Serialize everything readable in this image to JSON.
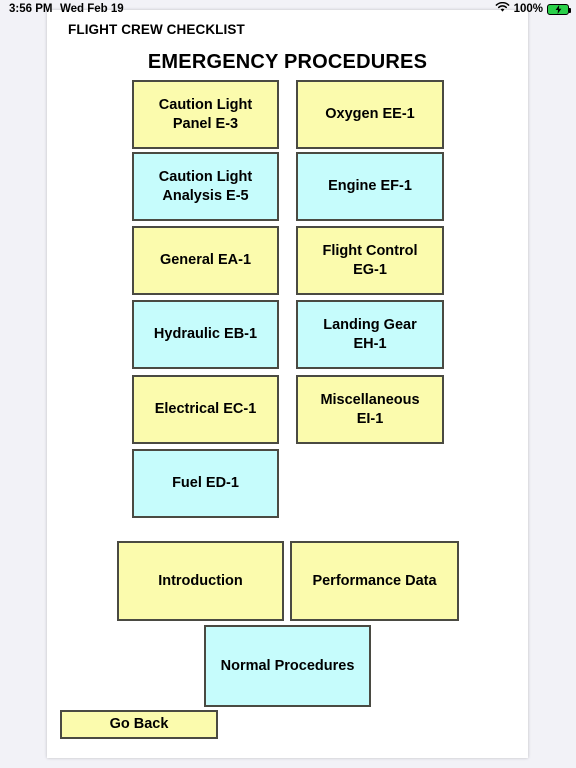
{
  "status_bar": {
    "time": "3:56 PM",
    "date": "Wed Feb 19",
    "battery_percent": "100%",
    "wifi_icon": "wifi-icon",
    "battery_icon": "battery-charging-icon"
  },
  "page": {
    "app_title": "FLIGHT CREW CHECKLIST",
    "heading": "EMERGENCY PROCEDURES"
  },
  "colors": {
    "yellow": "#FBFBAD",
    "cyan": "#C6FCFC",
    "border": "#4A4A42",
    "page_bg": "#FFFFFF",
    "desktop_bg": "#F2F2F7",
    "battery_green": "#2AD04A"
  },
  "procedure_buttons": [
    {
      "label": "Caution Light\nPanel E-3",
      "color": "yellow",
      "col": 0,
      "row": 0
    },
    {
      "label": "Oxygen  EE-1",
      "color": "yellow",
      "col": 1,
      "row": 0
    },
    {
      "label": "Caution  Light\nAnalysis  E-5",
      "color": "cyan",
      "col": 0,
      "row": 1
    },
    {
      "label": "Engine  EF-1",
      "color": "cyan",
      "col": 1,
      "row": 1
    },
    {
      "label": "General  EA-1",
      "color": "yellow",
      "col": 0,
      "row": 2
    },
    {
      "label": "Flight  Control\nEG-1",
      "color": "yellow",
      "col": 1,
      "row": 2
    },
    {
      "label": "Hydraulic  EB-1",
      "color": "cyan",
      "col": 0,
      "row": 3
    },
    {
      "label": "Landing  Gear\nEH-1",
      "color": "cyan",
      "col": 1,
      "row": 3
    },
    {
      "label": "Electrical  EC-1",
      "color": "yellow",
      "col": 0,
      "row": 4
    },
    {
      "label": "Miscellaneous\nEI-1",
      "color": "yellow",
      "col": 1,
      "row": 4
    },
    {
      "label": "Fuel ED-1",
      "color": "cyan",
      "col": 0,
      "row": 5
    }
  ],
  "section_buttons": {
    "introduction": "Introduction",
    "performance_data": "Performance  Data",
    "normal_procedures": "Normal  Procedures"
  },
  "nav": {
    "go_back": "Go Back"
  }
}
